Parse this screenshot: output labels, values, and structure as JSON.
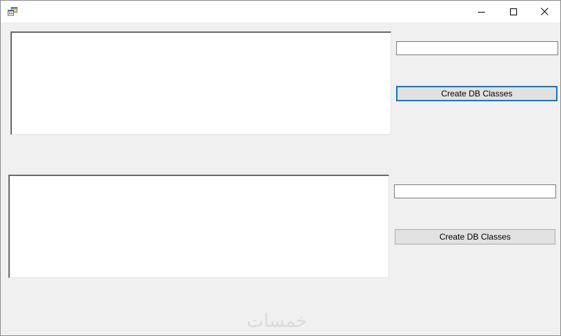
{
  "window": {
    "title": "",
    "icon": "app-form-icon",
    "controls": {
      "minimize": "minimize-icon",
      "maximize": "maximize-icon",
      "close": "close-icon"
    }
  },
  "top_group": {
    "list_items": [],
    "input_value": "",
    "button_label": "Create DB Classes"
  },
  "bottom_group": {
    "list_items": [],
    "input_value": "",
    "button_label": "Create DB Classes"
  },
  "watermark": "خمسات",
  "colors": {
    "title_bar": "#ffffff",
    "form_background": "#f0f0f0",
    "focus_border": "#0078d7",
    "button_face": "#e1e1e1"
  }
}
